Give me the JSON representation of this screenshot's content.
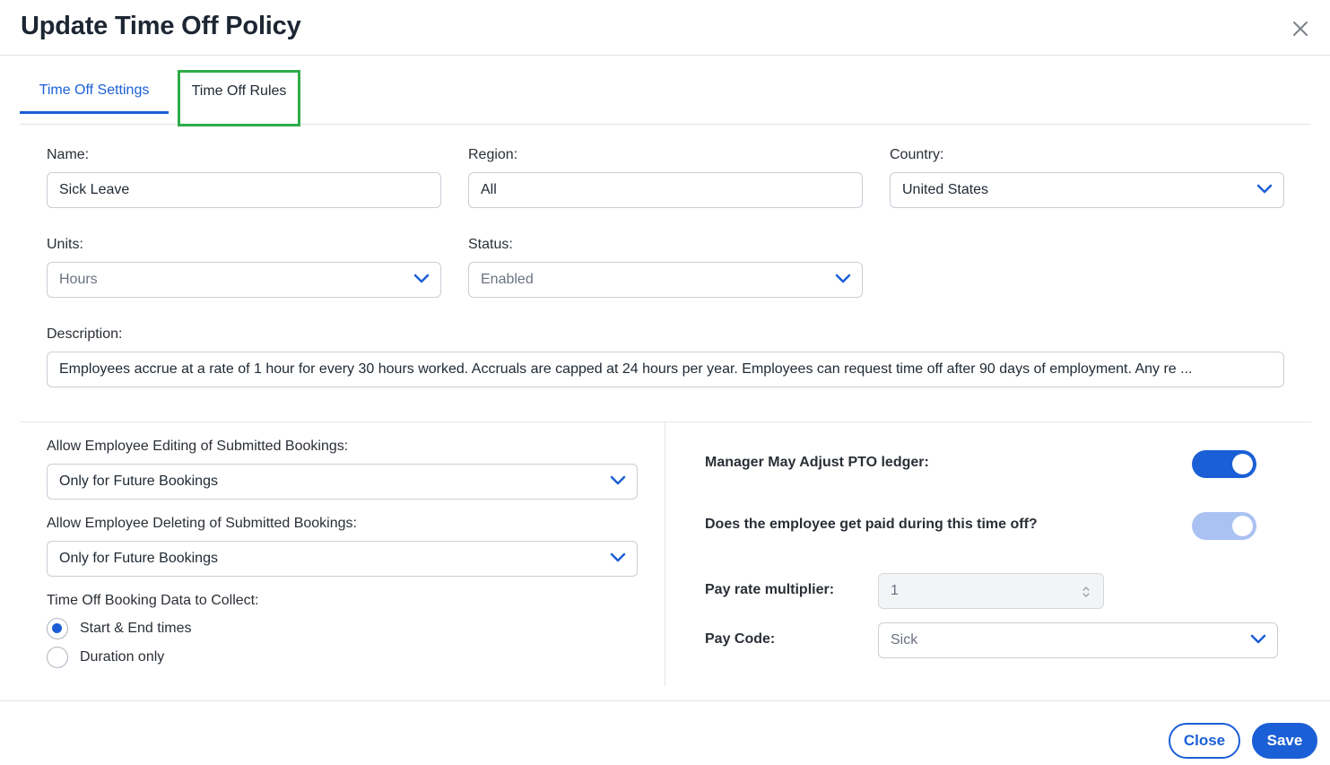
{
  "dialog": {
    "title": "Update Time Off Policy"
  },
  "tabs": [
    {
      "label": "Time Off Settings",
      "active": true
    },
    {
      "label": "Time Off Rules",
      "active": false
    }
  ],
  "form": {
    "name": {
      "label": "Name:",
      "value": "Sick Leave"
    },
    "region": {
      "label": "Region:",
      "value": "All"
    },
    "country": {
      "label": "Country:",
      "value": "United States"
    },
    "units": {
      "label": "Units:",
      "value": "Hours"
    },
    "status": {
      "label": "Status:",
      "value": "Enabled"
    },
    "description": {
      "label": "Description:",
      "value": "Employees accrue at a rate of 1 hour for every 30 hours worked.  Accruals are capped at 24 hours per year. Employees can request time off after 90 days of employment. Any re ..."
    }
  },
  "bookings": {
    "editing": {
      "label": "Allow Employee Editing of Submitted Bookings:",
      "value": "Only for Future Bookings"
    },
    "deleting": {
      "label": "Allow Employee Deleting of Submitted Bookings:",
      "value": "Only for Future Bookings"
    },
    "collect": {
      "label": "Time Off Booking Data to Collect:",
      "options": [
        {
          "label": "Start & End times",
          "checked": true
        },
        {
          "label": "Duration only",
          "checked": false
        }
      ]
    }
  },
  "pay": {
    "manager_adjust": {
      "label": "Manager May Adjust PTO ledger:",
      "on": true
    },
    "paid_time_off": {
      "label": "Does the employee get paid during this time off?",
      "on": true,
      "disabled": true
    },
    "multiplier": {
      "label": "Pay rate multiplier:",
      "value": "1"
    },
    "pay_code": {
      "label": "Pay Code:",
      "value": "Sick"
    }
  },
  "footer": {
    "close_label": "Close",
    "save_label": "Save"
  },
  "colors": {
    "accent": "#1b5fd6",
    "toggle_on": "#1b5fd6",
    "toggle_disabled": "#a9c2f2",
    "highlight_box": "#2eac4a"
  }
}
